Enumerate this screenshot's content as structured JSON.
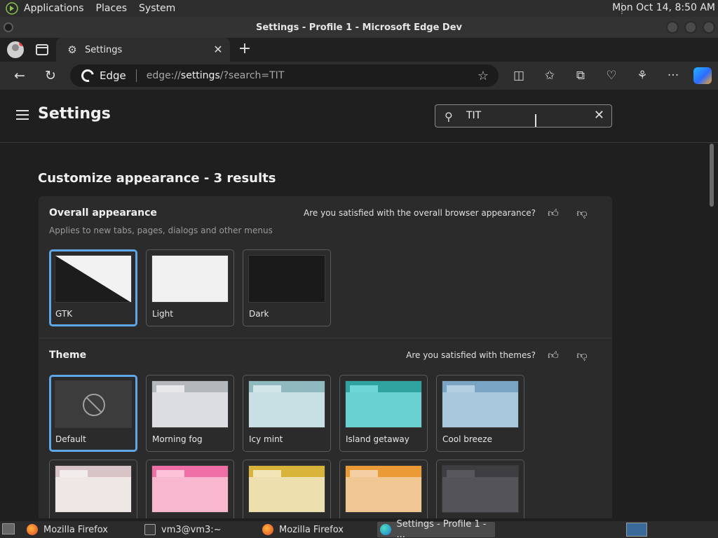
{
  "top_panel": {
    "menus": [
      "Applications",
      "Places",
      "System"
    ],
    "clock": "Mon Oct 14,  8:50 AM"
  },
  "window": {
    "title": "Settings - Profile 1 - Microsoft Edge Dev"
  },
  "tabs": [
    {
      "label": "Settings",
      "icon": "gear-icon"
    }
  ],
  "addressbar": {
    "brand": "Edge",
    "url_host": "edge://",
    "url_path": "settings",
    "url_query": "/?search=TIT"
  },
  "settings": {
    "title": "Settings",
    "search_value": "TIT",
    "results_title": "Customize appearance - 3 results",
    "overall": {
      "title": "Overall appearance",
      "subtitle": "Applies to new tabs, pages, dialogs and other menus",
      "feedback": "Are you satisfied with the overall browser appearance?",
      "options": [
        {
          "label": "GTK",
          "selected": true
        },
        {
          "label": "Light",
          "selected": false
        },
        {
          "label": "Dark",
          "selected": false
        }
      ]
    },
    "theme": {
      "title": "Theme",
      "feedback": "Are you satisfied with themes?",
      "options": [
        {
          "label": "Default",
          "selected": true,
          "colors": null
        },
        {
          "label": "Morning fog",
          "selected": false,
          "colors": {
            "back": "#b4b8bc",
            "tab": "#e8e8ea",
            "front": "#dcdde0"
          }
        },
        {
          "label": "Icy mint",
          "selected": false,
          "colors": {
            "back": "#8fb9bf",
            "tab": "#d2e6ea",
            "front": "#c8e0e4"
          }
        },
        {
          "label": "Island getaway",
          "selected": false,
          "colors": {
            "back": "#2fa3a0",
            "tab": "#6ed6d4",
            "front": "#69d1d0"
          }
        },
        {
          "label": "Cool breeze",
          "selected": false,
          "colors": {
            "back": "#7aa4c4",
            "tab": "#b4cfe2",
            "front": "#a9c7dd"
          }
        }
      ],
      "options_row2": [
        {
          "colors": {
            "back": "#d8c4c6",
            "tab": "#f3ecec",
            "front": "#efe6e6"
          }
        },
        {
          "colors": {
            "back": "#f06ea6",
            "tab": "#fbc2d8",
            "front": "#f8b6cf"
          }
        },
        {
          "colors": {
            "back": "#d8b43a",
            "tab": "#f2e6b8",
            "front": "#ede0ae"
          }
        },
        {
          "colors": {
            "back": "#ec9a36",
            "tab": "#f4cfa4",
            "front": "#f0c692"
          }
        },
        {
          "colors": {
            "back": "#3e3e42",
            "tab": "#58585c",
            "front": "#545458"
          }
        }
      ]
    }
  },
  "taskbar": {
    "items": [
      "Mozilla Firefox",
      "vm3@vm3:~",
      "Mozilla Firefox",
      "Settings - Profile 1 - ..."
    ]
  },
  "colors": {
    "accent": "#5ea6e6",
    "page_bg": "#1f1f1f",
    "card_bg": "#2b2b2b"
  }
}
